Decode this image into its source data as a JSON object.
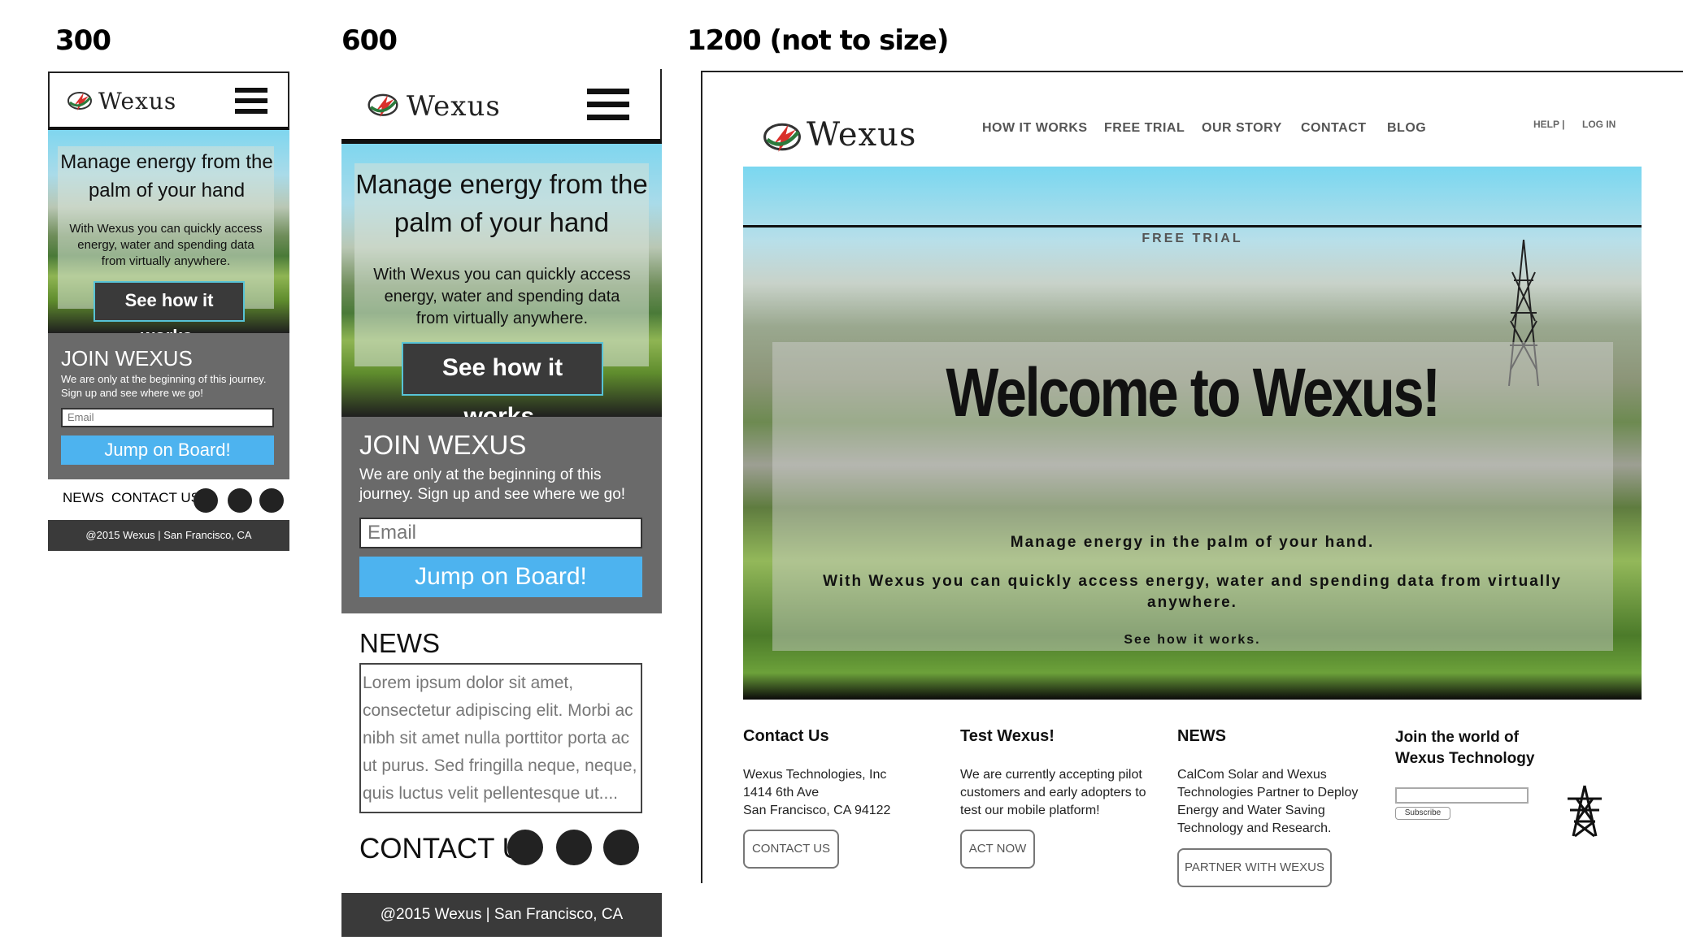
{
  "labels": {
    "w300": "300",
    "w600": "600",
    "w1200": "1200 (not to size)"
  },
  "brand": {
    "name": "Wexus"
  },
  "hero": {
    "title": "Manage energy from the palm of your hand",
    "subtitle": "With Wexus you can quickly access energy, water and spending data from virtually anywhere.",
    "cta": "See how it works."
  },
  "join": {
    "title": "JOIN WEXUS",
    "text": "We are only at the beginning of this journey. Sign up and see where we go!",
    "email_placeholder": "Email",
    "button": "Jump on Board!"
  },
  "mobile_footer": {
    "news": "NEWS",
    "contact": "CONTACT US",
    "copyright": "@2015 Wexus | San Francisco, CA"
  },
  "tablet": {
    "news_title": "NEWS",
    "news_body": "Lorem ipsum dolor sit amet, consectetur adipiscing elit. Morbi ac nibh sit amet nulla porttitor porta ac ut purus. Sed fringilla neque, neque, quis luctus velit pellentesque ut....",
    "contact_title": "CONTACT US"
  },
  "desktop": {
    "nav": [
      "HOW IT WORKS",
      "FREE TRIAL",
      "OUR STORY",
      "CONTACT",
      "BLOG"
    ],
    "help": "HELP |",
    "login": "LOG IN",
    "free_trial": "FREE TRIAL",
    "welcome": "Welcome to Wexus!",
    "tagline": "Manage energy in the palm of your hand.",
    "description": "With Wexus you can quickly access energy, water and spending data from virtually anywhere.",
    "cta": "See how it works.",
    "columns": {
      "contact": {
        "title": "Contact Us",
        "lines": [
          "Wexus Technologies, Inc",
          "1414 6th Ave",
          "San Francisco, CA 94122"
        ],
        "button": "CONTACT US"
      },
      "test": {
        "title": "Test Wexus!",
        "lines": [
          "We are currently accepting pilot",
          "customers and early adopters to",
          "test our mobile platform!"
        ],
        "button": "ACT NOW"
      },
      "news": {
        "title": "NEWS",
        "lines": [
          "CalCom Solar and Wexus",
          "Technologies Partner to Deploy",
          "Energy and Water Saving",
          "Technology and Research."
        ],
        "button": "PARTNER WITH WEXUS"
      },
      "join": {
        "title_lines": [
          "Join the world of",
          "Wexus Technology"
        ],
        "subscribe": "Subscribe"
      }
    }
  },
  "colors": {
    "accent_blue": "#4db3ef",
    "dark": "#3a3a3a",
    "join_bg": "#6a6a6a"
  }
}
